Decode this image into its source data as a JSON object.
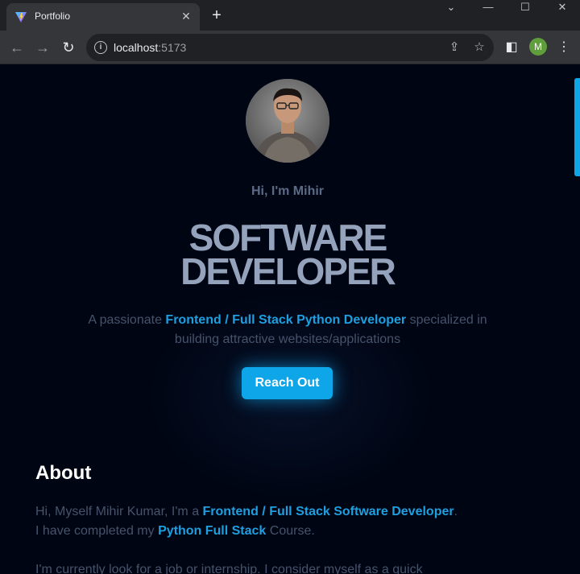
{
  "browser": {
    "tab_title": "Portfolio",
    "url_host": "localhost",
    "url_port": ":5173",
    "profile_initial": "M"
  },
  "hero": {
    "greeting": "Hi, I'm Mihir",
    "title_line1": "SOFTWARE",
    "title_line2": "DEVELOPER",
    "tagline_pre": "A passionate ",
    "tagline_highlight": "Frontend / Full Stack Python Developer",
    "tagline_post": " specialized in building attractive websites/applications",
    "cta_label": "Reach Out"
  },
  "about": {
    "heading": "About",
    "p1_pre": "Hi, Myself Mihir Kumar, I'm a ",
    "p1_highlight": "Frontend / Full Stack Software Developer",
    "p1_post": ".",
    "p2_pre": "I have completed my ",
    "p2_highlight": "Python Full Stack",
    "p2_post": " Course.",
    "p3": "I'm currently look for a job or internship. I consider myself as a quick"
  },
  "colors": {
    "accent": "#0ea5e9",
    "background": "#000513"
  }
}
